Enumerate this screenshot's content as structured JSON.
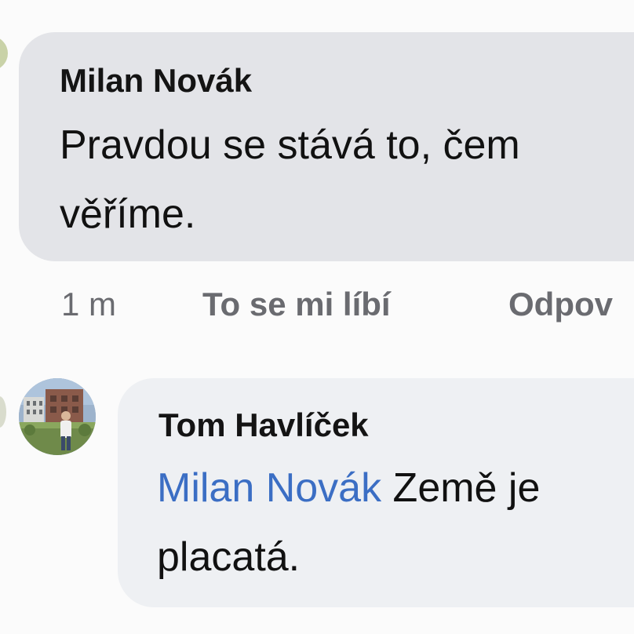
{
  "comments": [
    {
      "author": "Milan Novák",
      "lines": [
        "Pravdou se stává to, čem",
        "věříme."
      ],
      "meta": {
        "time": "1 m",
        "like": "To se mi líbí",
        "reply": "Odpov"
      }
    },
    {
      "author": "Tom Havlíček",
      "mention": "Milan Novák",
      "line1_rest": " Země je",
      "line2": "placatá."
    }
  ],
  "colors": {
    "bubble_primary": "#e3e4e8",
    "bubble_secondary": "#eef0f3",
    "mention": "#3b6ec4",
    "meta_text": "#6a6b70"
  }
}
